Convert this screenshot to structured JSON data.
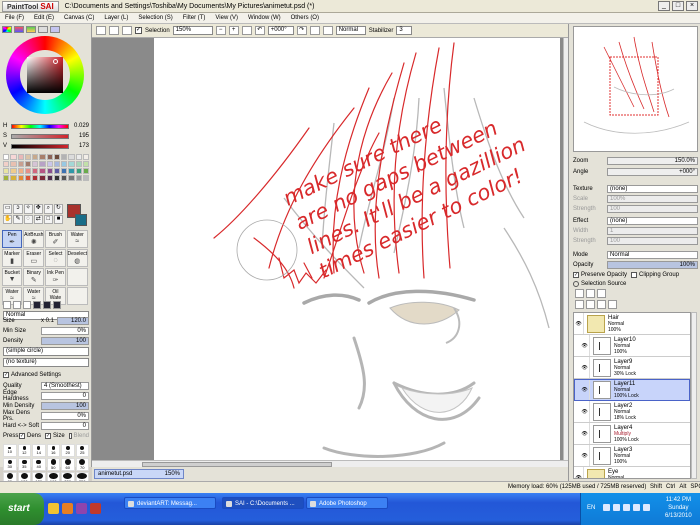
{
  "window": {
    "app_logo": "SAI",
    "app_logo_prefix": "PaintTool",
    "title": "C:\\Documents and Settings\\Toshiba\\My Documents\\My Pictures\\animetut.psd (*)"
  },
  "menu": [
    "File (F)",
    "Edit (E)",
    "Canvas (C)",
    "Layer (L)",
    "Selection (S)",
    "Filter (T)",
    "View (V)",
    "Window (W)",
    "Others (O)"
  ],
  "toolbar": {
    "selection_label": "Selection",
    "zoom": "150%",
    "angle": "+000°",
    "blend": "Normal",
    "stabilizer_label": "Stabilizer",
    "stabilizer_value": "3"
  },
  "color_sliders": [
    {
      "label": "H",
      "value": "0.029"
    },
    {
      "label": "S",
      "value": "195"
    },
    {
      "label": "V",
      "value": "173"
    }
  ],
  "brush_tools": [
    {
      "label": "Pen",
      "selected": true
    },
    {
      "label": "AirBrush",
      "selected": false
    },
    {
      "label": "Brush",
      "selected": false
    },
    {
      "label": "Water",
      "selected": false
    },
    {
      "label": "Marker",
      "selected": false
    },
    {
      "label": "Eraser",
      "selected": false
    },
    {
      "label": "Select",
      "selected": false
    },
    {
      "label": "Deselect",
      "selected": false
    },
    {
      "label": "Bucket",
      "selected": false
    },
    {
      "label": "Binary",
      "selected": false
    },
    {
      "label": "Ink Pen",
      "selected": false
    },
    {
      "label": "",
      "selected": false
    },
    {
      "label": "Water",
      "selected": false
    },
    {
      "label": "Water",
      "selected": false
    },
    {
      "label": "Oil Wate",
      "selected": false
    },
    {
      "label": "",
      "selected": false
    }
  ],
  "brush_props": {
    "mode": "Normal",
    "size_label": "Size",
    "size_mult": "x 0.1",
    "size_value": "120.0",
    "minsize_label": "Min Size",
    "minsize_value": "0%",
    "density_label": "Density",
    "density_value": "100",
    "shape": "(simple circle)",
    "texture": "(no texture)",
    "advanced_label": "Advanced Settings",
    "quality_label": "Quality",
    "quality_value": "4 (Smoothest)",
    "edge_label": "Edge Hardness",
    "edge_value": "0",
    "mindensity_label": "Min Density",
    "mindensity_value": "100",
    "maxdens_label": "Max Dens Prs.",
    "maxdens_value": "0%",
    "hardsoft_label": "Hard <-> Soft",
    "hardsoft_value": "0",
    "press_label": "Press:",
    "dens_label": "Dens",
    "size_chk_label": "Size",
    "blend_chk_label": "Blend"
  },
  "brush_sizes": [
    "10",
    "12",
    "14",
    "16",
    "20",
    "25",
    "30",
    "35",
    "40",
    "50",
    "60",
    "70",
    "80",
    "100",
    "120",
    "160",
    "200",
    "250"
  ],
  "canvas": {
    "annotation_lines": [
      "make sure there",
      "are no gaps between",
      "lines. It'll be a gazillion",
      "times easier to color!"
    ],
    "annotation_color": "#d8292b"
  },
  "document_tab": {
    "name": "animetut.psd",
    "zoom": "150%"
  },
  "navigator": {
    "zoom_label": "Zoom",
    "zoom_value": "150.0%",
    "angle_label": "Angle",
    "angle_value": "+000°"
  },
  "layer_props": {
    "texture_label": "Texture",
    "texture_value": "(none)",
    "scale_label": "Scale",
    "scale_value": "100%",
    "strength_label": "Strength",
    "strength_value": "100",
    "effect_label": "Effect",
    "effect_value": "(none)",
    "width_label": "Width",
    "width_value": "1",
    "strength2_value": "100",
    "mode_label": "Mode",
    "mode_value": "Normal",
    "opacity_label": "Opacity",
    "opacity_value": "100%",
    "preserve_label": "Preserve Opacity",
    "clipping_label": "Clipping Group",
    "selsource_label": "Selection Source"
  },
  "layers": [
    {
      "name": "Hair",
      "mode": "Normal",
      "opacity": "100%",
      "type": "folder",
      "selected": false,
      "indented": false
    },
    {
      "name": "Layer10",
      "mode": "Normal",
      "opacity": "100%",
      "type": "layer",
      "selected": false,
      "indented": true
    },
    {
      "name": "Layer9",
      "mode": "Normal",
      "opacity": "30% Lock",
      "type": "layer",
      "selected": false,
      "indented": true
    },
    {
      "name": "Layer11",
      "mode": "Normal",
      "opacity": "100% Lock",
      "type": "layer",
      "selected": true,
      "indented": true
    },
    {
      "name": "Layer2",
      "mode": "Normal",
      "opacity": "18% Lock",
      "type": "layer",
      "selected": false,
      "indented": true
    },
    {
      "name": "Layer4",
      "mode": "Multiply",
      "opacity": "100% Lock",
      "type": "layer",
      "selected": false,
      "indented": true
    },
    {
      "name": "Layer3",
      "mode": "Normal",
      "opacity": "100%",
      "type": "layer",
      "selected": false,
      "indented": true
    },
    {
      "name": "Eye",
      "mode": "Normal",
      "opacity": "26%",
      "type": "folder",
      "selected": false,
      "indented": false
    }
  ],
  "status": {
    "memory": "Memory load: 60% (125MB used / 725MB reserved)",
    "keys": [
      "Shift",
      "Ctrl",
      "Alt",
      "SPC"
    ]
  },
  "taskbar": {
    "start": "start",
    "tasks": [
      {
        "label": "deviantART: Messag...",
        "active": false
      },
      {
        "label": "SAI - C:\\Documents ...",
        "active": true
      },
      {
        "label": "Adobe Photoshop",
        "active": false
      }
    ],
    "lang": "EN",
    "time": "11:42 PM",
    "day": "Sunday",
    "date": "6/13/2010"
  },
  "swatch_colors": [
    "#ffffff",
    "#f7d7d7",
    "#e8b8b8",
    "#d9c3a8",
    "#c7a98c",
    "#a87f6c",
    "#8c6458",
    "#6c4a3c",
    "#b3b3b3",
    "#dcdcdc",
    "#ebebeb",
    "#f2eee8",
    "#f2d0c8",
    "#e8c0b0",
    "#c89f8f",
    "#a07c6c",
    "#d5c4d5",
    "#b8a2c6",
    "#cac6ea",
    "#a6b8de",
    "#98c9e2",
    "#a3d8d6",
    "#a9d7b9",
    "#c2e0a8",
    "#e7e3a3",
    "#eecb8c",
    "#f1b087",
    "#e78f87",
    "#d1687e",
    "#b65684",
    "#8b4f8e",
    "#5d5aa2",
    "#3d73b2",
    "#2f98a8",
    "#3aa17b",
    "#6bab4b",
    "#a0b23c",
    "#d6b23a",
    "#e48a36",
    "#d95336",
    "#ab2f34",
    "#7c2a3a",
    "#4f2c4c",
    "#333333",
    "#555555",
    "#777777",
    "#999999",
    "#bbbbbb"
  ]
}
